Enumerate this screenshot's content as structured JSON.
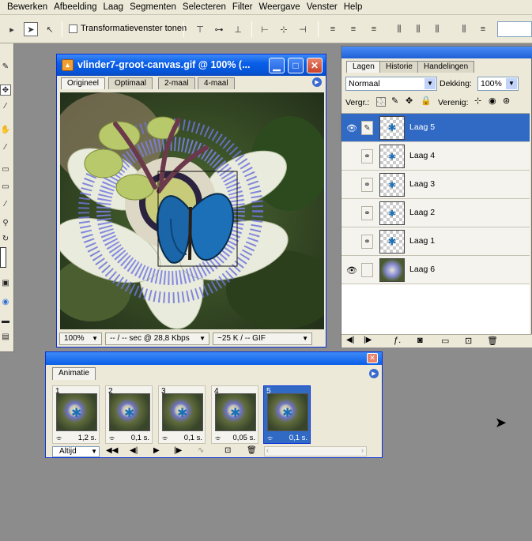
{
  "menubar": {
    "items": [
      "Bewerken",
      "Afbeelding",
      "Laag",
      "Segmenten",
      "Selecteren",
      "Filter",
      "Weergave",
      "Venster",
      "Help"
    ]
  },
  "options_bar": {
    "transform_label": "Transformatievenster tonen"
  },
  "document": {
    "title": "vlinder7-groot-canvas.gif @ 100% (...",
    "tabs": [
      "Origineel",
      "Optimaal",
      "2-maal",
      "4-maal"
    ],
    "zoom": "100%",
    "speed": "-- / -- sec @ 28,8 Kbps",
    "size": "~25 K / -- GIF"
  },
  "layers_panel": {
    "tabs": [
      "Lagen",
      "Historie",
      "Handelingen"
    ],
    "blend_mode": "Normaal",
    "opacity_label": "Dekking:",
    "opacity_value": "100%",
    "lock_label": "Vergr.:",
    "unify_label": "Verenig:",
    "layers": [
      {
        "name": "Laag 5",
        "visible": true,
        "selected": true
      },
      {
        "name": "Laag 4",
        "visible": false,
        "selected": false
      },
      {
        "name": "Laag 3",
        "visible": false,
        "selected": false
      },
      {
        "name": "Laag 2",
        "visible": false,
        "selected": false
      },
      {
        "name": "Laag 1",
        "visible": false,
        "selected": false
      },
      {
        "name": "Laag 6",
        "visible": true,
        "selected": false
      }
    ]
  },
  "animation_panel": {
    "tab": "Animatie",
    "loop": "Altijd",
    "frames": [
      {
        "number": "1",
        "delay": "1,2 s."
      },
      {
        "number": "2",
        "delay": "0,1 s."
      },
      {
        "number": "3",
        "delay": "0,1 s."
      },
      {
        "number": "4",
        "delay": "0,05 s."
      },
      {
        "number": "5",
        "delay": "0,1 s.",
        "selected": true
      }
    ]
  },
  "colors": {
    "titlebar": "#0a5fe8",
    "selection": "#316ac5",
    "panel_bg": "#ece9d8",
    "desktop": "#8c8c8c"
  }
}
